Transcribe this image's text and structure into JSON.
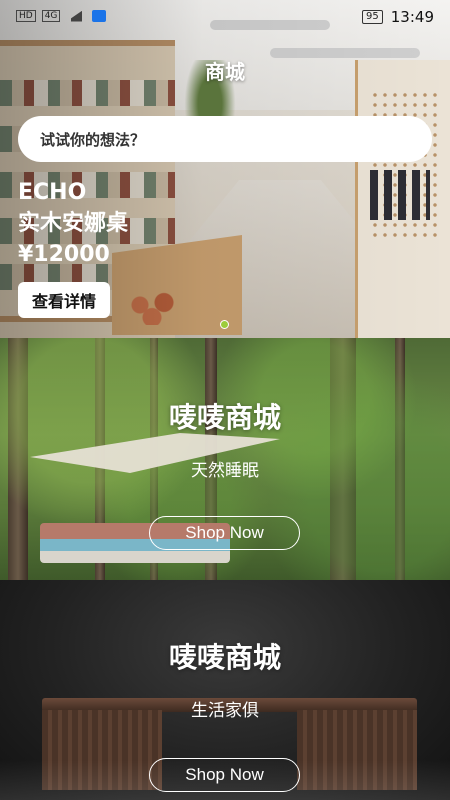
{
  "status_bar": {
    "left_labels": [
      "HD",
      "4G"
    ],
    "battery": "95",
    "time": "13:49"
  },
  "page": {
    "title": "商城"
  },
  "search": {
    "placeholder": "试试你的想法？"
  },
  "hero": {
    "brand": "ECHO",
    "product_name": "实木安娜桌",
    "price": "¥12000",
    "detail_button": "查看详情",
    "carousel": {
      "count": 1,
      "active_index": 0
    }
  },
  "banners": [
    {
      "title": "唛唛商城",
      "subtitle": "天然睡眠",
      "button": "Shop Now"
    },
    {
      "title": "唛唛商城",
      "subtitle": "生活家俱",
      "button": "Shop Now"
    }
  ]
}
